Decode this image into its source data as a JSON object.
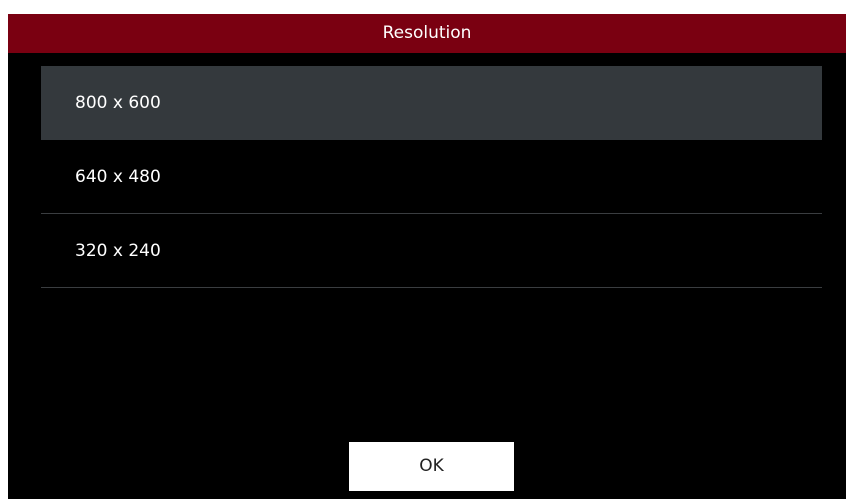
{
  "dialog": {
    "title": "Resolution",
    "options": [
      {
        "label": "800 x 600",
        "selected": true
      },
      {
        "label": "640 x 480",
        "selected": false
      },
      {
        "label": "320 x 240",
        "selected": false
      }
    ],
    "ok_label": "OK"
  },
  "colors": {
    "title_bar": "#7a0011",
    "selected_row": "#34393d",
    "background": "#000000",
    "divider": "#3a3d40"
  }
}
